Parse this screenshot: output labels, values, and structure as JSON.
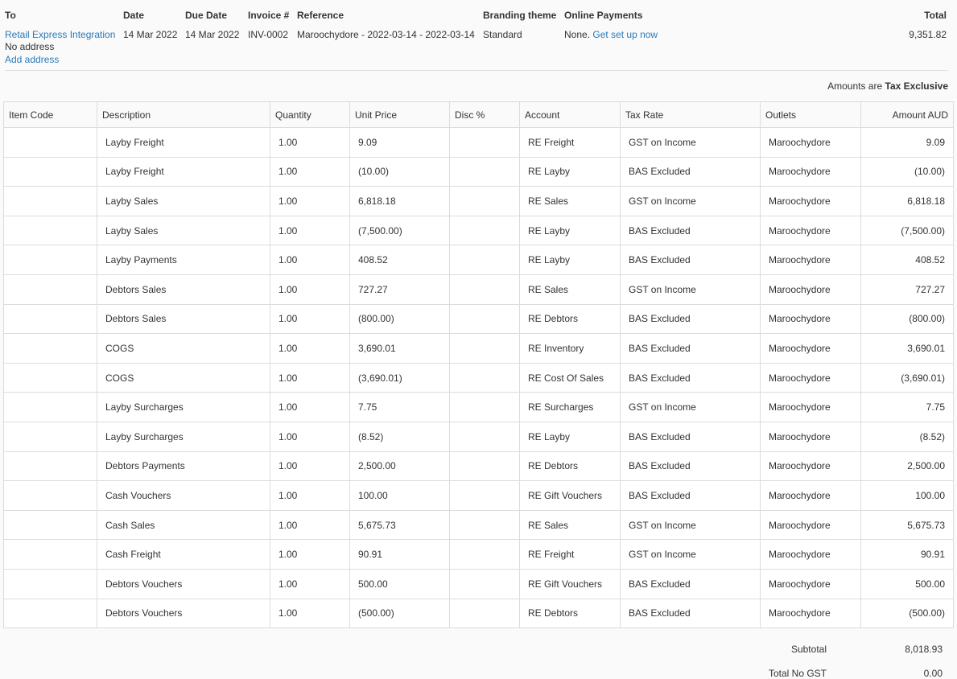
{
  "header": {
    "to_label": "To",
    "to_value": "Retail Express Integration",
    "no_address": "No address",
    "add_address": "Add address",
    "date_label": "Date",
    "date_value": "14 Mar 2022",
    "due_label": "Due Date",
    "due_value": "14 Mar 2022",
    "invoice_label": "Invoice #",
    "invoice_value": "INV-0002",
    "reference_label": "Reference",
    "reference_value": "Maroochydore - 2022-03-14 - 2022-03-14",
    "branding_label": "Branding theme",
    "branding_value": "Standard",
    "online_label": "Online Payments",
    "online_value": "None.",
    "online_link": "Get set up now",
    "total_label": "Total",
    "total_value": "9,351.82"
  },
  "amounts_note": {
    "prefix": "Amounts are",
    "mode": "Tax Exclusive"
  },
  "table": {
    "columns": [
      "Item Code",
      "Description",
      "Quantity",
      "Unit Price",
      "Disc %",
      "Account",
      "Tax Rate",
      "Outlets",
      "Amount AUD"
    ],
    "rows": [
      {
        "code": "",
        "desc": "Layby Freight",
        "qty": "1.00",
        "price": "9.09",
        "disc": "",
        "account": "RE Freight",
        "tax": "GST on Income",
        "outlet": "Maroochydore",
        "amount": "9.09"
      },
      {
        "code": "",
        "desc": "Layby Freight",
        "qty": "1.00",
        "price": "(10.00)",
        "disc": "",
        "account": "RE Layby",
        "tax": "BAS Excluded",
        "outlet": "Maroochydore",
        "amount": "(10.00)"
      },
      {
        "code": "",
        "desc": "Layby Sales",
        "qty": "1.00",
        "price": "6,818.18",
        "disc": "",
        "account": "RE Sales",
        "tax": "GST on Income",
        "outlet": "Maroochydore",
        "amount": "6,818.18"
      },
      {
        "code": "",
        "desc": "Layby Sales",
        "qty": "1.00",
        "price": "(7,500.00)",
        "disc": "",
        "account": "RE Layby",
        "tax": "BAS Excluded",
        "outlet": "Maroochydore",
        "amount": "(7,500.00)"
      },
      {
        "code": "",
        "desc": "Layby Payments",
        "qty": "1.00",
        "price": "408.52",
        "disc": "",
        "account": "RE Layby",
        "tax": "BAS Excluded",
        "outlet": "Maroochydore",
        "amount": "408.52"
      },
      {
        "code": "",
        "desc": "Debtors Sales",
        "qty": "1.00",
        "price": "727.27",
        "disc": "",
        "account": "RE Sales",
        "tax": "GST on Income",
        "outlet": "Maroochydore",
        "amount": "727.27"
      },
      {
        "code": "",
        "desc": "Debtors Sales",
        "qty": "1.00",
        "price": "(800.00)",
        "disc": "",
        "account": "RE Debtors",
        "tax": "BAS Excluded",
        "outlet": "Maroochydore",
        "amount": "(800.00)"
      },
      {
        "code": "",
        "desc": "COGS",
        "qty": "1.00",
        "price": "3,690.01",
        "disc": "",
        "account": "RE Inventory",
        "tax": "BAS Excluded",
        "outlet": "Maroochydore",
        "amount": "3,690.01"
      },
      {
        "code": "",
        "desc": "COGS",
        "qty": "1.00",
        "price": "(3,690.01)",
        "disc": "",
        "account": "RE Cost Of Sales",
        "tax": "BAS Excluded",
        "outlet": "Maroochydore",
        "amount": "(3,690.01)"
      },
      {
        "code": "",
        "desc": "Layby Surcharges",
        "qty": "1.00",
        "price": "7.75",
        "disc": "",
        "account": "RE Surcharges",
        "tax": "GST on Income",
        "outlet": "Maroochydore",
        "amount": "7.75"
      },
      {
        "code": "",
        "desc": "Layby Surcharges",
        "qty": "1.00",
        "price": "(8.52)",
        "disc": "",
        "account": "RE Layby",
        "tax": "BAS Excluded",
        "outlet": "Maroochydore",
        "amount": "(8.52)"
      },
      {
        "code": "",
        "desc": "Debtors Payments",
        "qty": "1.00",
        "price": "2,500.00",
        "disc": "",
        "account": "RE Debtors",
        "tax": "BAS Excluded",
        "outlet": "Maroochydore",
        "amount": "2,500.00"
      },
      {
        "code": "",
        "desc": "Cash Vouchers",
        "qty": "1.00",
        "price": "100.00",
        "disc": "",
        "account": "RE Gift Vouchers",
        "tax": "BAS Excluded",
        "outlet": "Maroochydore",
        "amount": "100.00"
      },
      {
        "code": "",
        "desc": "Cash Sales",
        "qty": "1.00",
        "price": "5,675.73",
        "disc": "",
        "account": "RE Sales",
        "tax": "GST on Income",
        "outlet": "Maroochydore",
        "amount": "5,675.73"
      },
      {
        "code": "",
        "desc": "Cash Freight",
        "qty": "1.00",
        "price": "90.91",
        "disc": "",
        "account": "RE Freight",
        "tax": "GST on Income",
        "outlet": "Maroochydore",
        "amount": "90.91"
      },
      {
        "code": "",
        "desc": "Debtors Vouchers",
        "qty": "1.00",
        "price": "500.00",
        "disc": "",
        "account": "RE Gift Vouchers",
        "tax": "BAS Excluded",
        "outlet": "Maroochydore",
        "amount": "500.00"
      },
      {
        "code": "",
        "desc": "Debtors Vouchers",
        "qty": "1.00",
        "price": "(500.00)",
        "disc": "",
        "account": "RE Debtors",
        "tax": "BAS Excluded",
        "outlet": "Maroochydore",
        "amount": "(500.00)"
      }
    ]
  },
  "totals": {
    "subtotal_label": "Subtotal",
    "subtotal_value": "8,018.93",
    "nogst_label": "Total No GST",
    "nogst_value": "0.00"
  }
}
